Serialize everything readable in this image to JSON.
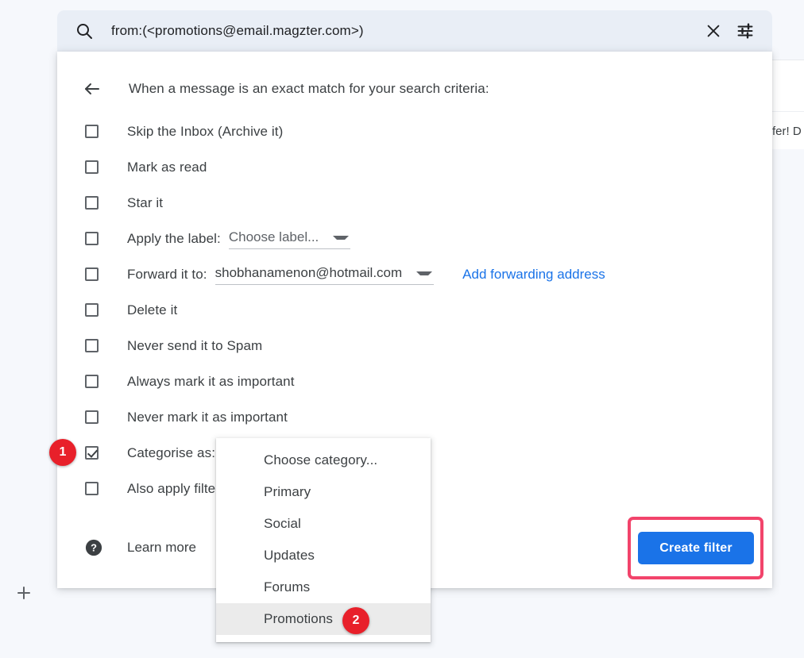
{
  "page": {
    "background_color": "#f6f8fc",
    "accent_blue": "#1a73e8",
    "badge_red": "#e8202a",
    "highlight_pink": "#f2446b"
  },
  "search": {
    "value": "from:(<promotions@email.magzter.com>)",
    "placeholder": "Search mail",
    "search_icon": "search-icon",
    "clear_icon": "close-icon",
    "options_icon": "tune-icon"
  },
  "background_mail": {
    "snippet": "fer! D"
  },
  "dialog": {
    "back_icon": "arrow-left-icon",
    "title": "When a message is an exact match for your search criteria:",
    "options": [
      {
        "label": "Skip the Inbox (Archive it)",
        "checked": false
      },
      {
        "label": "Mark as read",
        "checked": false
      },
      {
        "label": "Star it",
        "checked": false
      },
      {
        "label": "Apply the label:",
        "checked": false,
        "select_value": "Choose label...",
        "select_is_placeholder": true
      },
      {
        "label": "Forward it to:",
        "checked": false,
        "select_value": "shobhanamenon@hotmail.com",
        "select_is_placeholder": false,
        "link": "Add forwarding address"
      },
      {
        "label": "Delete it",
        "checked": false
      },
      {
        "label": "Never send it to Spam",
        "checked": false
      },
      {
        "label": "Always mark it as important",
        "checked": false
      },
      {
        "label": "Never mark it as important",
        "checked": false
      },
      {
        "label": "Categorise as:",
        "checked": true
      },
      {
        "label": "Also apply filter",
        "checked": false
      }
    ],
    "learn_more": {
      "icon": "help-circle-icon",
      "label": "Learn more"
    },
    "create_filter_label": "Create filter"
  },
  "category_menu": {
    "items": [
      {
        "label": "Choose category...",
        "hovered": false
      },
      {
        "label": "Primary",
        "hovered": false
      },
      {
        "label": "Social",
        "hovered": false
      },
      {
        "label": "Updates",
        "hovered": false
      },
      {
        "label": "Forums",
        "hovered": false
      },
      {
        "label": "Promotions",
        "hovered": true
      }
    ]
  },
  "annotations": {
    "badge_1": "1",
    "badge_2": "2"
  },
  "compose": {
    "plus_icon": "plus-icon"
  }
}
